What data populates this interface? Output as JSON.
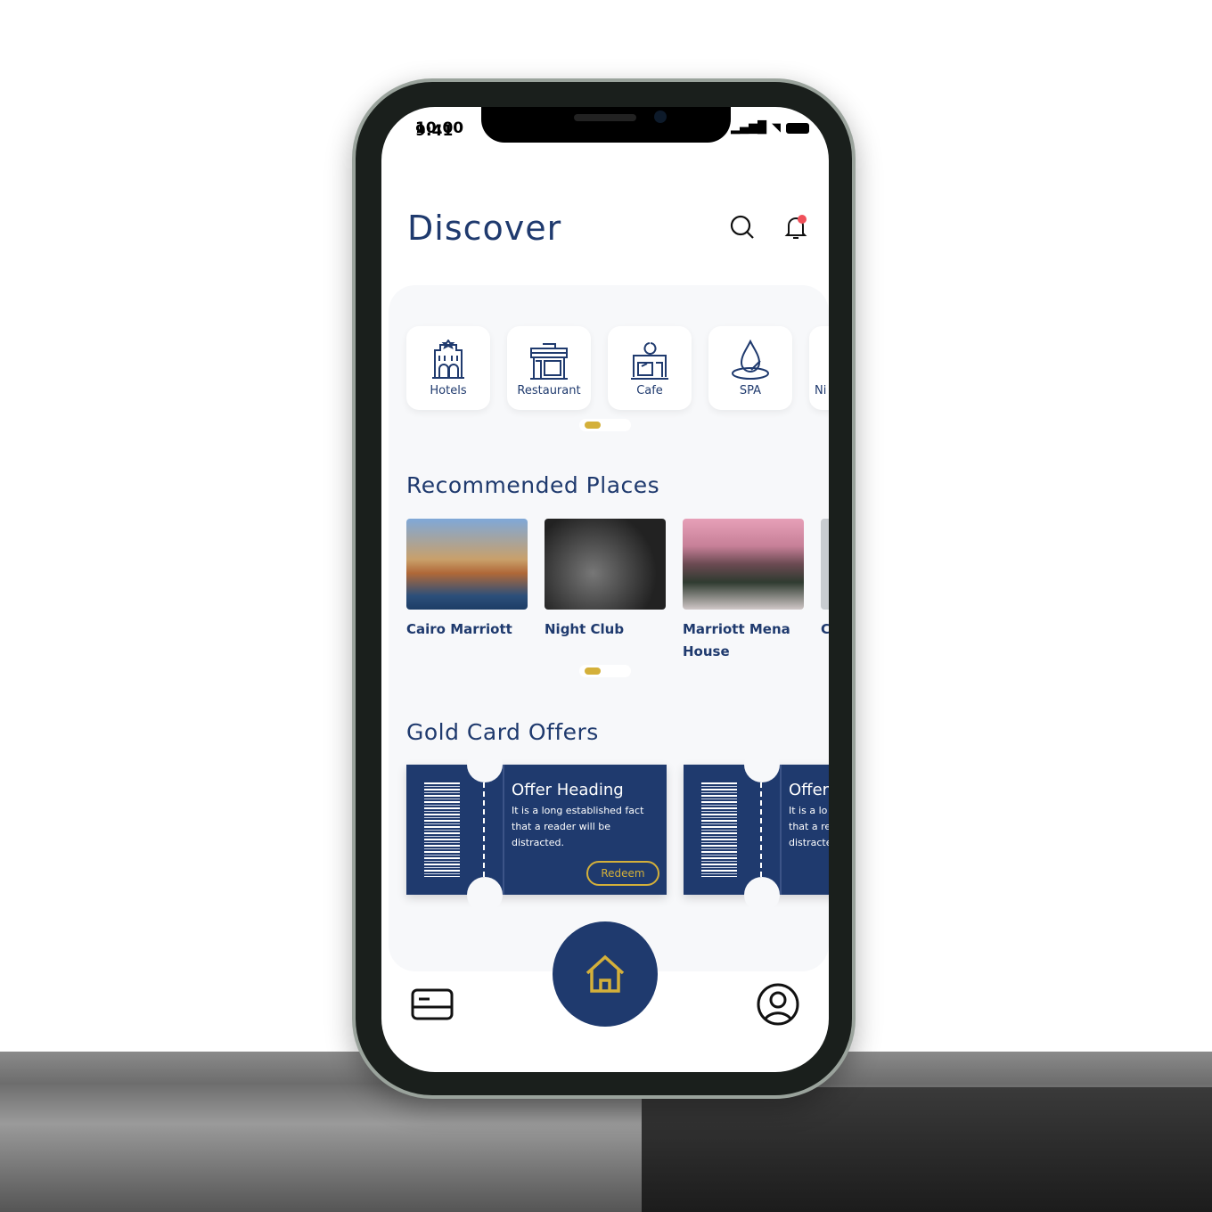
{
  "status": {
    "time_a": "10:00",
    "time_b": "9:41"
  },
  "header": {
    "title": "Discover",
    "icons": [
      "search-icon",
      "bell-icon"
    ],
    "notification_dot": true
  },
  "categories": [
    {
      "label": "Hotels",
      "icon": "hotel-icon"
    },
    {
      "label": "Restaurant",
      "icon": "restaurant-icon"
    },
    {
      "label": "Cafe",
      "icon": "cafe-icon"
    },
    {
      "label": "SPA",
      "icon": "spa-icon"
    },
    {
      "label": "Ni",
      "icon": "nightlife-icon"
    }
  ],
  "recommended": {
    "title": "Recommended Places",
    "items": [
      {
        "name": "Cairo Marriott"
      },
      {
        "name": "Night Club"
      },
      {
        "name": "Marriott Mena House"
      },
      {
        "name": "C"
      }
    ]
  },
  "offers": {
    "title": "Gold Card Offers",
    "items": [
      {
        "heading": "Offer Heading",
        "text": "It is a long established fact that a reader will be distracted.",
        "button": "Redeem"
      },
      {
        "heading": "Offer",
        "text": "It is a lo that a re distracte",
        "button": ""
      }
    ]
  },
  "nav": {
    "items": [
      "card-icon",
      "home-icon",
      "profile-icon"
    ],
    "active": "home-icon"
  },
  "colors": {
    "primary": "#1f3a6e",
    "accent": "#d4b03a",
    "notification": "#f0505a"
  }
}
